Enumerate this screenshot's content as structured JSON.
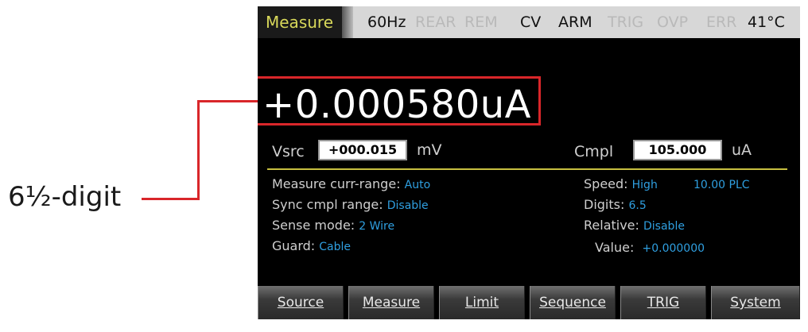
{
  "callout": {
    "label": "6½-digit"
  },
  "colors": {
    "highlight": "#d9262a",
    "accent_blue": "#2f9fe0",
    "tab_yellow": "#d8d85a",
    "divider": "#c8c040"
  },
  "status": {
    "mode": "Measure",
    "freq": "60Hz",
    "rear": "REAR",
    "rem": "REM",
    "cv": "CV",
    "arm": "ARM",
    "trig": "TRIG",
    "ovp": "OVP",
    "err": "ERR",
    "temp": "41°C"
  },
  "reading": {
    "value": "+0.000580uA"
  },
  "source": {
    "label": "Vsrc",
    "value": "+000.015",
    "unit": "mV"
  },
  "compliance": {
    "label": "Cmpl",
    "value": "105.000",
    "unit": "uA"
  },
  "settings_left": [
    {
      "label": "Measure curr-range:",
      "value": "Auto"
    },
    {
      "label": "Sync cmpl range:",
      "value": "Disable"
    },
    {
      "label": "Sense mode:",
      "value": "2 Wire"
    },
    {
      "label": "Guard:",
      "value": "Cable"
    }
  ],
  "settings_right": {
    "speed": {
      "label": "Speed:",
      "value": "High",
      "extra": "10.00 PLC"
    },
    "digits": {
      "label": "Digits:",
      "value": "6.5"
    },
    "relative": {
      "label": "Relative:",
      "value": "Disable"
    },
    "value": {
      "label": "Value:",
      "value": "+0.000000"
    }
  },
  "softkeys": [
    "Source",
    "Measure",
    "Limit",
    "Sequence",
    "TRIG",
    "System"
  ]
}
